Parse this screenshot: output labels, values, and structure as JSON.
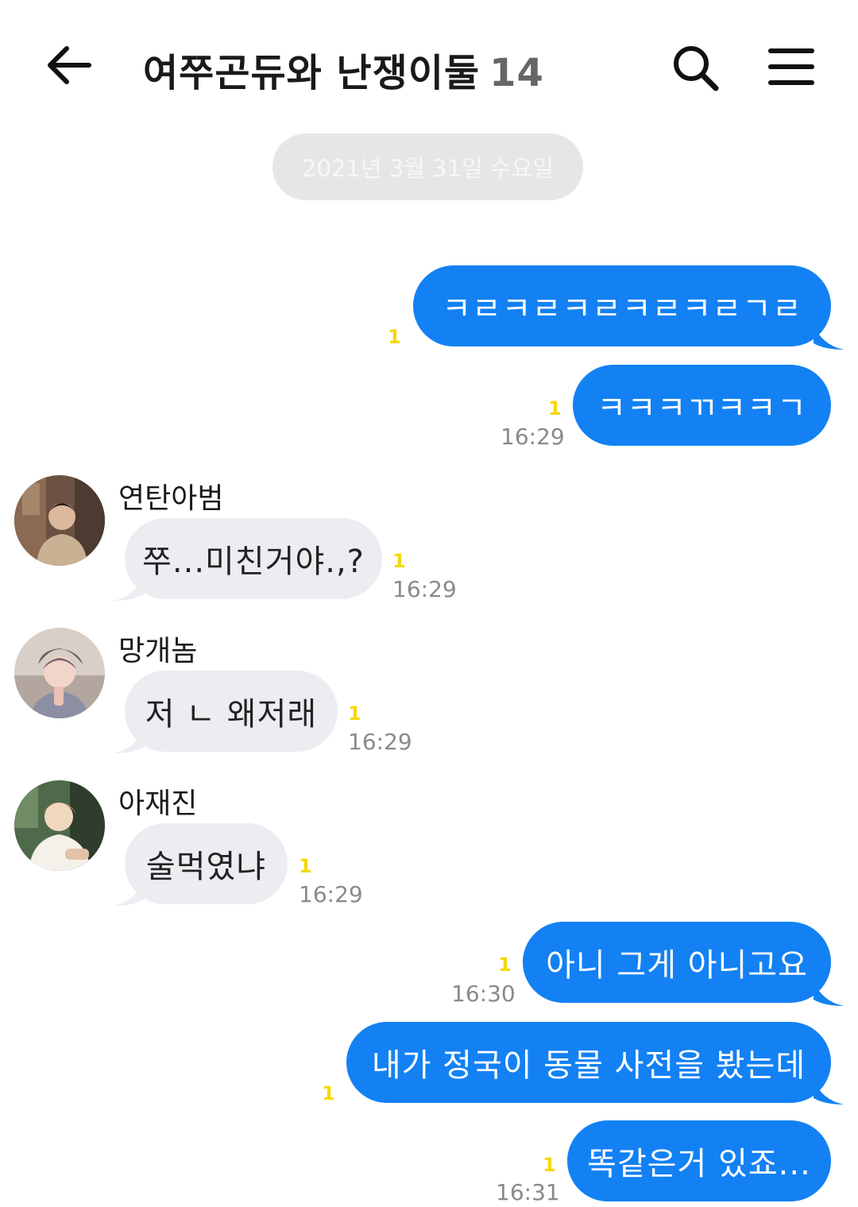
{
  "header": {
    "title": "여쭈곤듀와 난쟁이둘",
    "member_count": "14"
  },
  "date_divider": "2021년 3월 31일 수요일",
  "messages": [
    {
      "text": "ㅋㄹㅋㄹㅋㄹㅋㄹㅋㄹㄱㄹ",
      "unread": "1",
      "time": ""
    },
    {
      "text": "ㅋㅋㅋㄲㅋㅋㄱ",
      "unread": "1",
      "time": "16:29"
    },
    {
      "sender": "연탄아범",
      "text": "쭈...미친거야.,?",
      "unread": "1",
      "time": "16:29"
    },
    {
      "sender": "망개놈",
      "text": "저 ㄴ 왜저래",
      "unread": "1",
      "time": "16:29"
    },
    {
      "sender": "아재진",
      "text": "술먹였냐",
      "unread": "1",
      "time": "16:29"
    },
    {
      "text": "아니 그게 아니고요",
      "unread": "1",
      "time": "16:30"
    },
    {
      "text": "내가 정국이 동물 사전을 봤는데",
      "unread": "1",
      "time": ""
    },
    {
      "text": "똑같은거 있죠...",
      "unread": "1",
      "time": "16:31"
    }
  ],
  "colors": {
    "outgoing_bubble": "#1381f3",
    "incoming_bubble": "#ececf1",
    "unread_count": "#f5d80a"
  },
  "icons": {
    "back": "back-arrow-icon",
    "search": "search-icon",
    "menu": "hamburger-menu-icon"
  }
}
